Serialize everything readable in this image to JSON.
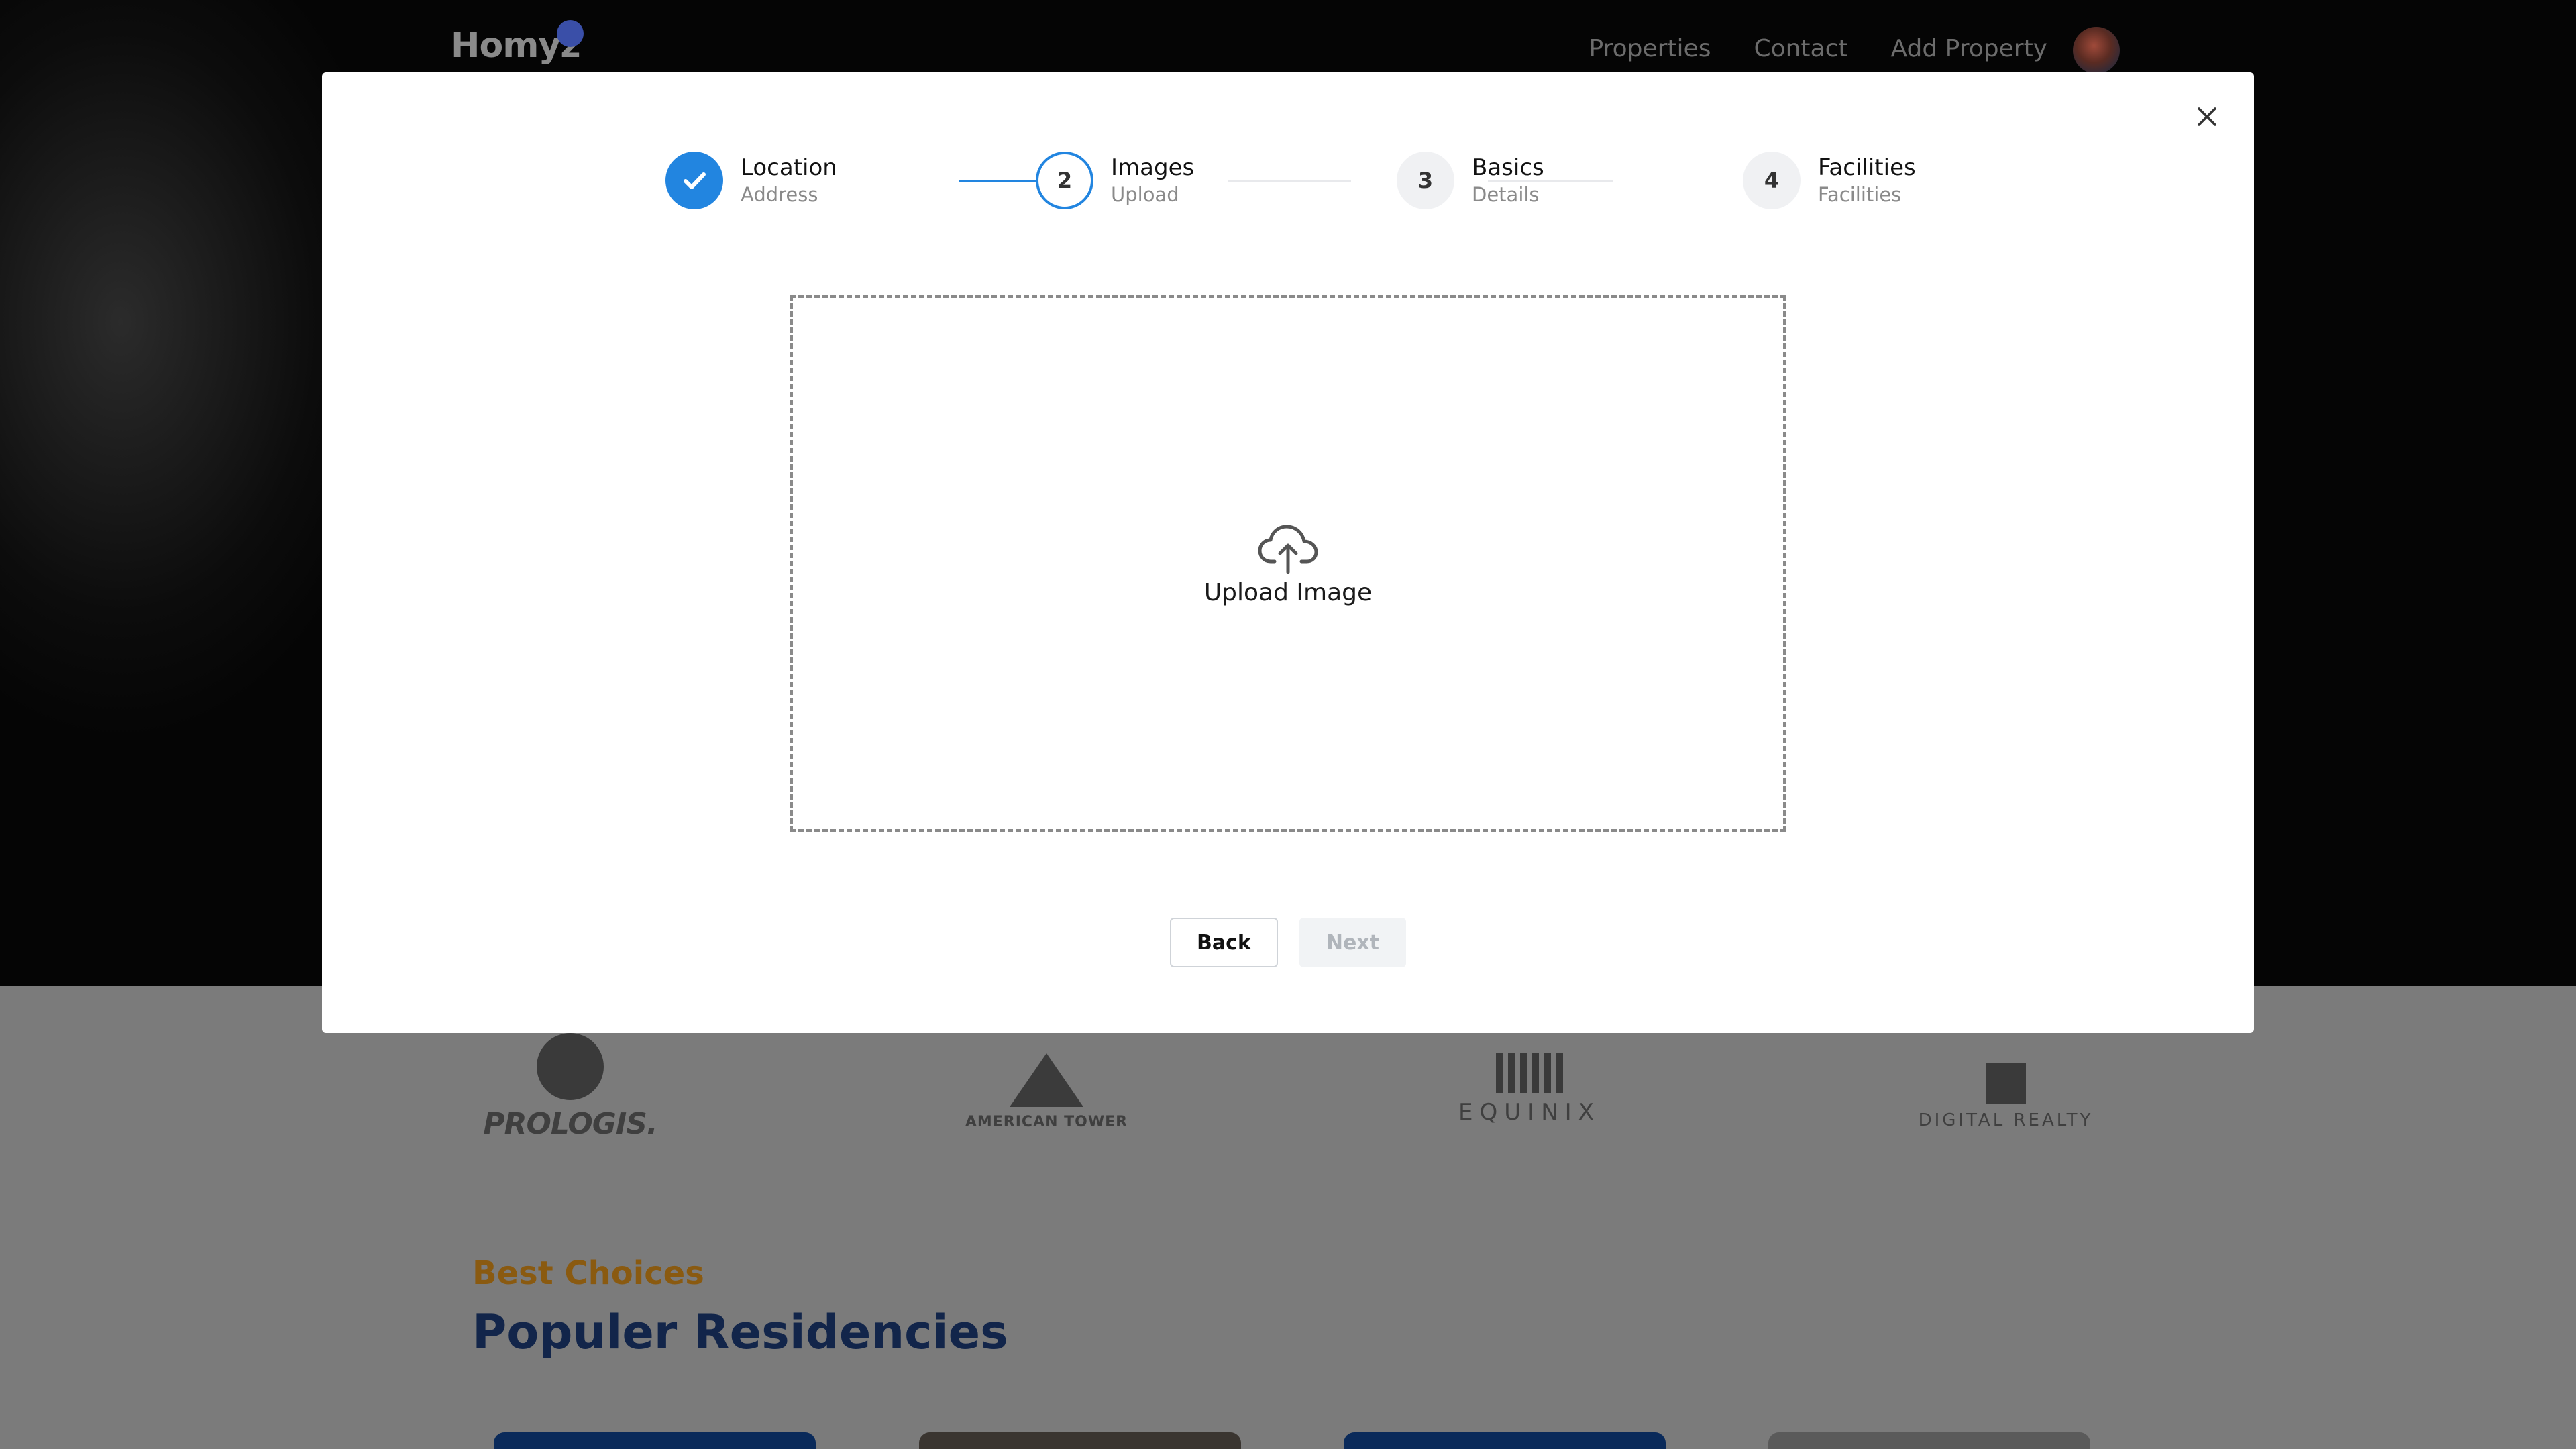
{
  "navbar": {
    "logo": "Homyz",
    "links": [
      "Properties",
      "Contact",
      "Add Property"
    ]
  },
  "companies": [
    "PROLOGIS.",
    "AMERICAN TOWER",
    "EQUINIX",
    "DIGITAL REALTY"
  ],
  "residencies": {
    "kicker": "Best Choices",
    "title": "Populer Residencies"
  },
  "modal": {
    "steps": [
      {
        "number": "",
        "label": "Location",
        "description": "Address",
        "state": "done"
      },
      {
        "number": "2",
        "label": "Images",
        "description": "Upload",
        "state": "active"
      },
      {
        "number": "3",
        "label": "Basics",
        "description": "Details",
        "state": "pending"
      },
      {
        "number": "4",
        "label": "Facilities",
        "description": "Facilities",
        "state": "pending"
      }
    ],
    "upload": {
      "label": "Upload Image",
      "icon": "cloud-upload-icon"
    },
    "buttons": {
      "back": "Back",
      "next": "Next"
    },
    "close_icon": "close-icon"
  },
  "colors": {
    "accent": "#2285e0",
    "kicker": "#8a5a10",
    "title": "#12254a"
  }
}
